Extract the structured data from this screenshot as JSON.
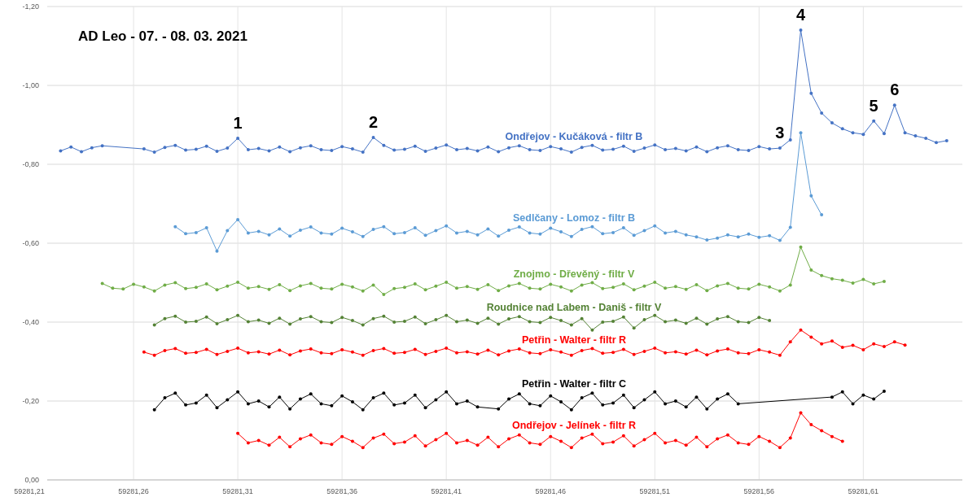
{
  "chart": {
    "chart_data": {
      "type": "line",
      "title": "AD Leo - 07. - 08. 03.  2021",
      "grid": true,
      "xlim": [
        59281.21,
        59281.6575
      ],
      "ylim": [
        0,
        -1.2
      ],
      "xticks": [
        {
          "value": 59281.21,
          "label": "59281,21"
        },
        {
          "value": 59281.26,
          "label": "59281,26"
        },
        {
          "value": 59281.31,
          "label": "59281,31"
        },
        {
          "value": 59281.36,
          "label": "59281,36"
        },
        {
          "value": 59281.41,
          "label": "59281,41"
        },
        {
          "value": 59281.46,
          "label": "59281,46"
        },
        {
          "value": 59281.51,
          "label": "59281,51"
        },
        {
          "value": 59281.56,
          "label": "59281,56"
        },
        {
          "value": 59281.61,
          "label": "59281,61"
        }
      ],
      "yticks": [
        {
          "value": -1.2,
          "label": "-1,20"
        },
        {
          "value": -1.0,
          "label": "-1,00"
        },
        {
          "value": -0.8,
          "label": "-0,80"
        },
        {
          "value": -0.6,
          "label": "-0,60"
        },
        {
          "value": -0.4,
          "label": "-0,40"
        },
        {
          "value": -0.2,
          "label": "-0,20"
        },
        {
          "value": 0,
          "label": "0,00"
        }
      ],
      "x": [
        59281.225,
        59281.23,
        59281.235,
        59281.24,
        59281.245,
        59281.25,
        59281.255,
        59281.26,
        59281.265,
        59281.27,
        59281.275,
        59281.28,
        59281.285,
        59281.29,
        59281.295,
        59281.3,
        59281.305,
        59281.31,
        59281.315,
        59281.32,
        59281.325,
        59281.33,
        59281.335,
        59281.34,
        59281.345,
        59281.35,
        59281.355,
        59281.36,
        59281.365,
        59281.37,
        59281.375,
        59281.38,
        59281.385,
        59281.39,
        59281.395,
        59281.4,
        59281.405,
        59281.41,
        59281.415,
        59281.42,
        59281.425,
        59281.43,
        59281.435,
        59281.44,
        59281.445,
        59281.45,
        59281.455,
        59281.46,
        59281.465,
        59281.47,
        59281.475,
        59281.48,
        59281.485,
        59281.49,
        59281.495,
        59281.5,
        59281.505,
        59281.51,
        59281.515,
        59281.52,
        59281.525,
        59281.53,
        59281.535,
        59281.54,
        59281.545,
        59281.55,
        59281.555,
        59281.56,
        59281.565,
        59281.57,
        59281.575,
        59281.58,
        59281.585,
        59281.59,
        59281.595,
        59281.6,
        59281.605,
        59281.61,
        59281.615,
        59281.62,
        59281.625,
        59281.63,
        59281.635,
        59281.64,
        59281.645,
        59281.65
      ],
      "series": [
        {
          "name": "Ondřejov - Kučáková - filtr B",
          "color": "#4472c4",
          "values": [
            -0.834,
            -0.844,
            -0.832,
            -0.842,
            -0.847,
            null,
            null,
            null,
            -0.839,
            -0.831,
            -0.843,
            -0.848,
            -0.836,
            -0.838,
            -0.846,
            -0.833,
            -0.841,
            -0.866,
            -0.837,
            -0.84,
            -0.834,
            -0.844,
            -0.832,
            -0.842,
            -0.847,
            -0.837,
            -0.835,
            -0.845,
            -0.839,
            -0.831,
            -0.868,
            -0.848,
            -0.836,
            -0.838,
            -0.846,
            -0.833,
            -0.841,
            -0.849,
            -0.837,
            -0.84,
            -0.834,
            -0.844,
            -0.832,
            -0.842,
            -0.847,
            -0.837,
            -0.835,
            -0.845,
            -0.839,
            -0.831,
            -0.843,
            -0.848,
            -0.836,
            -0.838,
            -0.846,
            -0.833,
            -0.841,
            -0.849,
            -0.837,
            -0.84,
            -0.834,
            -0.844,
            -0.832,
            -0.842,
            -0.847,
            -0.837,
            -0.835,
            -0.845,
            -0.839,
            -0.841,
            -0.862,
            -1.14,
            -0.98,
            -0.93,
            -0.905,
            -0.89,
            -0.88,
            -0.876,
            -0.91,
            -0.878,
            -0.95,
            -0.88,
            -0.872,
            -0.866,
            -0.855,
            -0.86
          ]
        },
        {
          "name": "Sedlčany - Lomoz - filtr B",
          "color": "#5b9bd5",
          "values": [
            null,
            null,
            null,
            null,
            null,
            null,
            null,
            null,
            null,
            null,
            null,
            -0.642,
            -0.624,
            -0.627,
            -0.639,
            -0.58,
            -0.632,
            -0.66,
            -0.626,
            -0.63,
            -0.621,
            -0.636,
            -0.618,
            -0.633,
            -0.641,
            -0.626,
            -0.623,
            -0.638,
            -0.629,
            -0.617,
            -0.635,
            -0.642,
            -0.624,
            -0.627,
            -0.639,
            -0.62,
            -0.632,
            -0.644,
            -0.626,
            -0.63,
            -0.621,
            -0.636,
            -0.618,
            -0.633,
            -0.641,
            -0.626,
            -0.623,
            -0.638,
            -0.629,
            -0.617,
            -0.635,
            -0.642,
            -0.624,
            -0.627,
            -0.639,
            -0.62,
            -0.632,
            -0.644,
            -0.626,
            -0.63,
            -0.621,
            -0.616,
            -0.608,
            -0.613,
            -0.621,
            -0.616,
            -0.623,
            -0.615,
            -0.619,
            -0.607,
            -0.64,
            -0.88,
            -0.72,
            -0.672,
            null,
            null,
            null,
            null,
            null,
            null,
            null,
            null,
            null,
            null,
            null,
            null
          ]
        },
        {
          "name": "Znojmo - Dřevěný - filtr V",
          "color": "#70ad47",
          "values": [
            null,
            null,
            null,
            null,
            -0.498,
            -0.486,
            -0.484,
            -0.496,
            -0.489,
            -0.479,
            -0.494,
            -0.5,
            -0.485,
            -0.488,
            -0.497,
            -0.482,
            -0.491,
            -0.501,
            -0.486,
            -0.49,
            -0.483,
            -0.495,
            -0.48,
            -0.492,
            -0.498,
            -0.486,
            -0.484,
            -0.496,
            -0.489,
            -0.479,
            -0.494,
            -0.47,
            -0.485,
            -0.488,
            -0.497,
            -0.482,
            -0.491,
            -0.501,
            -0.486,
            -0.49,
            -0.483,
            -0.495,
            -0.48,
            -0.492,
            -0.498,
            -0.486,
            -0.484,
            -0.496,
            -0.489,
            -0.479,
            -0.494,
            -0.5,
            -0.485,
            -0.488,
            -0.497,
            -0.482,
            -0.491,
            -0.501,
            -0.486,
            -0.49,
            -0.483,
            -0.495,
            -0.48,
            -0.492,
            -0.498,
            -0.486,
            -0.484,
            -0.496,
            -0.489,
            -0.479,
            -0.494,
            -0.59,
            -0.532,
            -0.518,
            -0.51,
            -0.506,
            -0.499,
            -0.508,
            -0.497,
            -0.503,
            null,
            null,
            null,
            null,
            null,
            null
          ]
        },
        {
          "name": "Roudnice nad Labem - Daniš - filtr V",
          "color": "#548235",
          "values": [
            null,
            null,
            null,
            null,
            null,
            null,
            null,
            null,
            null,
            -0.393,
            -0.409,
            -0.415,
            -0.4,
            -0.402,
            -0.413,
            -0.396,
            -0.406,
            -0.417,
            -0.401,
            -0.405,
            -0.397,
            -0.41,
            -0.395,
            -0.408,
            -0.414,
            -0.401,
            -0.399,
            -0.412,
            -0.404,
            -0.393,
            -0.409,
            -0.415,
            -0.4,
            -0.402,
            -0.413,
            -0.396,
            -0.406,
            -0.417,
            -0.401,
            -0.405,
            -0.397,
            -0.41,
            -0.395,
            -0.408,
            -0.414,
            -0.401,
            -0.399,
            -0.412,
            -0.404,
            -0.393,
            -0.409,
            -0.38,
            -0.4,
            -0.402,
            -0.413,
            -0.385,
            -0.406,
            -0.417,
            -0.401,
            -0.405,
            -0.397,
            -0.41,
            -0.395,
            -0.408,
            -0.414,
            -0.401,
            -0.399,
            -0.412,
            -0.404,
            null,
            null,
            null,
            null,
            null,
            null,
            null,
            null,
            null,
            null,
            null,
            null,
            null,
            null,
            null,
            null,
            null
          ]
        },
        {
          "name": "Petřin - Walter - filtr R",
          "color": "#ff0000",
          "values": [
            null,
            null,
            null,
            null,
            null,
            null,
            null,
            null,
            -0.324,
            -0.316,
            -0.328,
            -0.333,
            -0.321,
            -0.323,
            -0.331,
            -0.318,
            -0.326,
            -0.334,
            -0.322,
            -0.325,
            -0.319,
            -0.329,
            -0.317,
            -0.327,
            -0.332,
            -0.322,
            -0.32,
            -0.33,
            -0.324,
            -0.316,
            -0.328,
            -0.333,
            -0.321,
            -0.323,
            -0.331,
            -0.318,
            -0.326,
            -0.334,
            -0.322,
            -0.325,
            -0.319,
            -0.329,
            -0.317,
            -0.327,
            -0.332,
            -0.322,
            -0.32,
            -0.33,
            -0.324,
            -0.316,
            -0.328,
            -0.333,
            -0.321,
            -0.323,
            -0.331,
            -0.318,
            -0.326,
            -0.334,
            -0.322,
            -0.325,
            -0.319,
            -0.329,
            -0.317,
            -0.327,
            -0.332,
            -0.322,
            -0.32,
            -0.33,
            -0.324,
            -0.316,
            -0.35,
            -0.38,
            -0.362,
            -0.345,
            -0.352,
            -0.336,
            -0.341,
            -0.33,
            -0.345,
            -0.338,
            -0.35,
            -0.342,
            null,
            null,
            null,
            null
          ]
        },
        {
          "name": "Petřin - Walter - filtr C",
          "color": "#000000",
          "values": [
            null,
            null,
            null,
            null,
            null,
            null,
            null,
            null,
            null,
            -0.178,
            -0.208,
            -0.22,
            -0.19,
            -0.195,
            -0.215,
            -0.183,
            -0.203,
            -0.223,
            -0.193,
            -0.2,
            -0.185,
            -0.21,
            -0.18,
            -0.205,
            -0.218,
            -0.193,
            -0.188,
            -0.213,
            -0.198,
            -0.178,
            -0.208,
            -0.22,
            -0.19,
            -0.195,
            -0.215,
            -0.183,
            -0.203,
            -0.223,
            -0.193,
            -0.2,
            -0.185,
            null,
            -0.18,
            -0.205,
            -0.218,
            -0.193,
            -0.188,
            -0.213,
            -0.198,
            -0.178,
            -0.208,
            -0.22,
            -0.19,
            -0.195,
            -0.215,
            -0.183,
            -0.203,
            -0.223,
            -0.193,
            -0.2,
            -0.185,
            -0.21,
            -0.18,
            -0.205,
            -0.218,
            -0.193,
            null,
            null,
            null,
            null,
            null,
            null,
            null,
            null,
            -0.21,
            -0.223,
            -0.193,
            -0.215,
            -0.205,
            -0.225,
            null,
            null,
            null,
            null,
            null,
            null
          ]
        },
        {
          "name": "Ondřejov - Jelínek - filtr R",
          "color": "#ff0000",
          "values": [
            null,
            null,
            null,
            null,
            null,
            null,
            null,
            null,
            null,
            null,
            null,
            null,
            null,
            null,
            null,
            null,
            null,
            -0.118,
            -0.094,
            -0.1,
            -0.088,
            -0.108,
            -0.084,
            -0.104,
            -0.114,
            -0.094,
            -0.09,
            -0.11,
            -0.098,
            -0.082,
            -0.106,
            -0.116,
            -0.092,
            -0.096,
            -0.112,
            -0.086,
            -0.102,
            -0.118,
            -0.094,
            -0.1,
            -0.088,
            -0.108,
            -0.084,
            -0.104,
            -0.114,
            -0.094,
            -0.09,
            -0.11,
            -0.098,
            -0.082,
            -0.106,
            -0.116,
            -0.092,
            -0.096,
            -0.112,
            -0.086,
            -0.102,
            -0.118,
            -0.094,
            -0.1,
            -0.088,
            -0.108,
            -0.084,
            -0.104,
            -0.114,
            -0.094,
            -0.09,
            -0.11,
            -0.098,
            -0.082,
            -0.106,
            -0.17,
            -0.14,
            -0.125,
            -0.11,
            -0.098,
            null,
            null,
            null,
            null,
            null,
            null,
            null,
            null,
            null,
            null
          ]
        }
      ],
      "annotations": [
        {
          "text": "1",
          "x": 59281.31,
          "y": -0.866
        },
        {
          "text": "2",
          "x": 59281.375,
          "y": -0.868
        },
        {
          "text": "3",
          "x": 59281.57,
          "y": -0.841
        },
        {
          "text": "4",
          "x": 59281.58,
          "y": -1.14
        },
        {
          "text": "5",
          "x": 59281.615,
          "y": -0.91
        },
        {
          "text": "6",
          "x": 59281.625,
          "y": -0.95
        }
      ]
    }
  }
}
